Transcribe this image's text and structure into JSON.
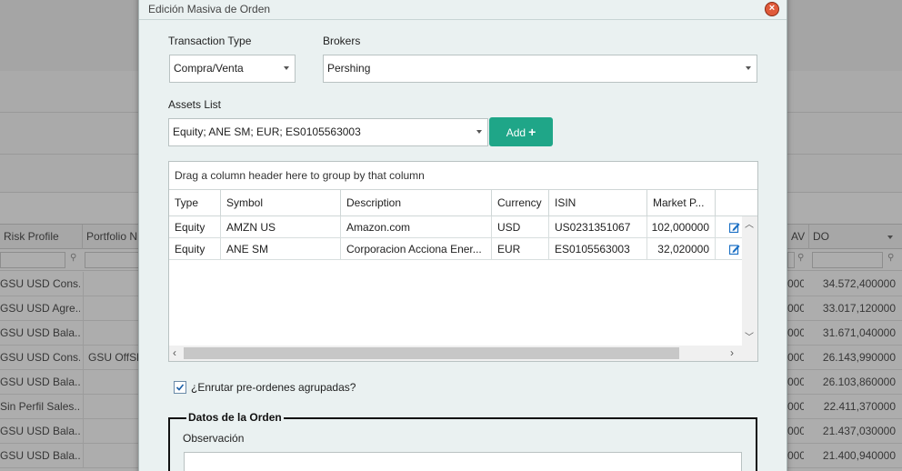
{
  "dialog": {
    "title": "Edición Masiva de Orden",
    "transaction_type": {
      "label": "Transaction Type",
      "value": "Compra/Venta"
    },
    "brokers": {
      "label": "Brokers",
      "value": "Pershing"
    },
    "assets_list": {
      "label": "Assets List",
      "value": "Equity; ANE SM; EUR; ES0105563003"
    },
    "add_button": "Add",
    "grid": {
      "group_hint": "Drag a column header here to group by that column",
      "columns": [
        "Type",
        "Symbol",
        "Description",
        "Currency",
        "ISIN",
        "Market P..."
      ],
      "rows": [
        [
          "Equity",
          "AMZN US",
          "Amazon.com",
          "USD",
          "US0231351067",
          "102,000000"
        ],
        [
          "Equity",
          "ANE SM",
          "Corporacion Acciona Ener...",
          "EUR",
          "ES0105563003",
          "32,020000"
        ]
      ]
    },
    "checkbox": {
      "label": "¿Enrutar pre-ordenes agrupadas?",
      "checked": true
    },
    "order_section": {
      "legend": "Datos de la Orden",
      "observation_label": "Observación"
    }
  },
  "background_grid": {
    "columns": {
      "risk_profile": "Risk Profile",
      "portfolio": "Portfolio N",
      "av": "AV",
      "do": "DO"
    },
    "rows": [
      {
        "risk": "GSU USD Cons...",
        "portfolio": "",
        "av": "000",
        "do": "34.572,400000"
      },
      {
        "risk": "GSU USD Agre...",
        "portfolio": "",
        "av": "000",
        "do": "33.017,120000"
      },
      {
        "risk": "GSU USD Bala...",
        "portfolio": "",
        "av": "000",
        "do": "31.671,040000"
      },
      {
        "risk": "GSU USD Cons...",
        "portfolio": "GSU OffSh",
        "av": "000",
        "do": "26.143,990000"
      },
      {
        "risk": "GSU USD Bala...",
        "portfolio": "",
        "av": "000",
        "do": "26.103,860000"
      },
      {
        "risk": "Sin Perfil Sales...",
        "portfolio": "",
        "av": "000",
        "do": "22.411,370000"
      },
      {
        "risk": "GSU USD Bala...",
        "portfolio": "",
        "av": "000",
        "do": "21.437,030000"
      },
      {
        "risk": "GSU USD Bala...",
        "portfolio": "",
        "av": "000",
        "do": "21.400,940000"
      }
    ]
  }
}
